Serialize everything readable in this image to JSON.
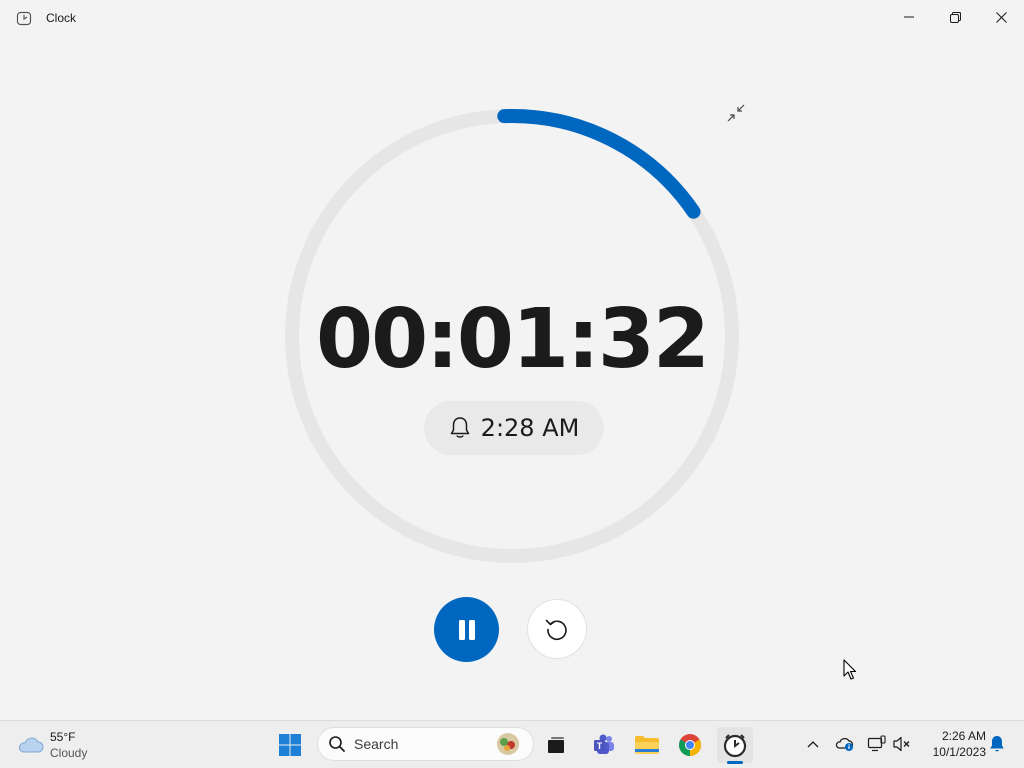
{
  "window": {
    "title": "Clock"
  },
  "timer": {
    "remaining": "00:01:32",
    "alarm_time": "2:28 AM",
    "progress_fraction": 0.16,
    "accent_color": "#0067c0",
    "track_color": "#e6e6e6"
  },
  "controls": {
    "pause_icon": "pause-icon",
    "reset_icon": "reset-icon",
    "compact_icon": "compact-overlay-icon"
  },
  "taskbar": {
    "weather": {
      "temperature": "55°F",
      "condition": "Cloudy"
    },
    "search_placeholder": "Search",
    "clock": {
      "time": "2:26 AM",
      "date": "10/1/2023"
    }
  }
}
